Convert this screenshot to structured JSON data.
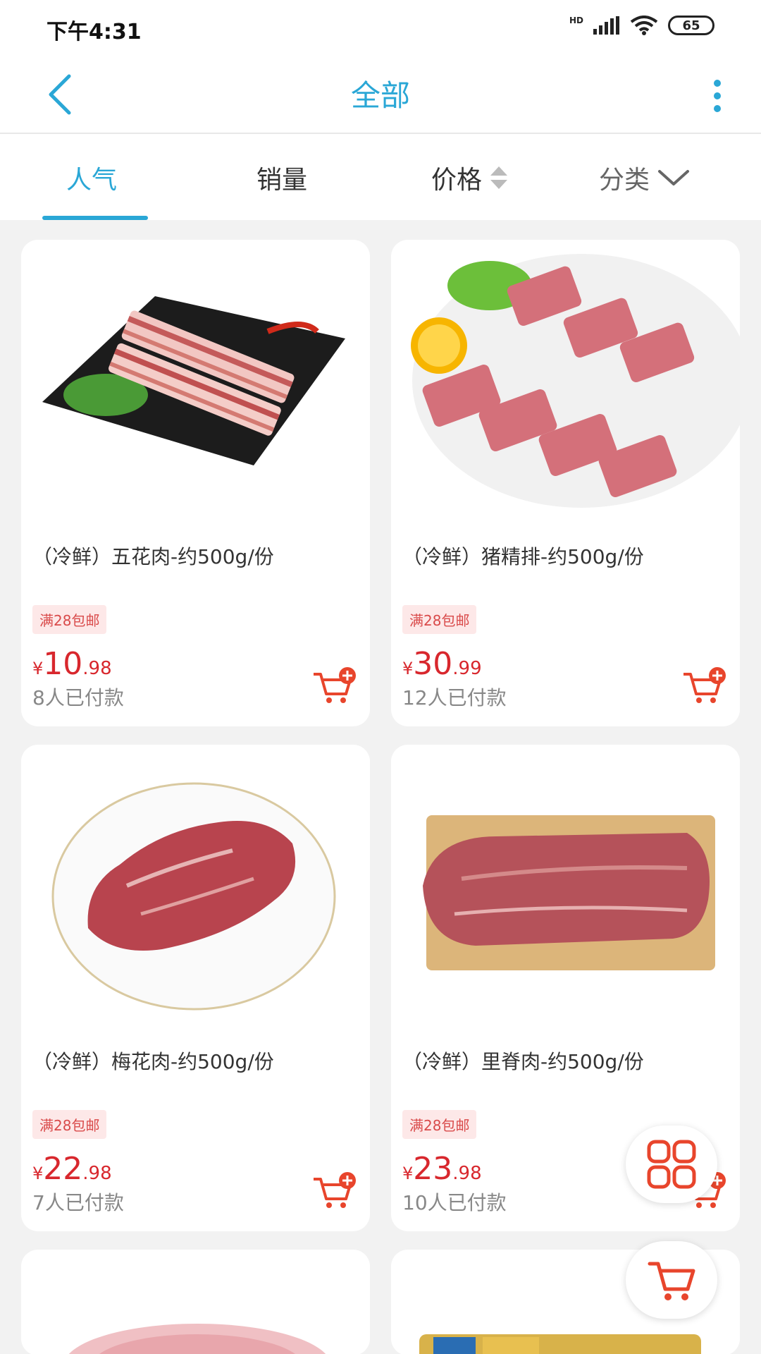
{
  "status_bar": {
    "time": "下午4:31",
    "hd_label": "HD",
    "battery": "65",
    "icons": [
      "signal-icon",
      "wifi-icon",
      "battery-icon"
    ]
  },
  "nav": {
    "title": "全部",
    "back_icon": "chevron-left-icon",
    "more_icon": "more-vertical-icon"
  },
  "filters": {
    "tabs": [
      {
        "label": "人气",
        "active": true
      },
      {
        "label": "销量",
        "active": false
      },
      {
        "label": "价格",
        "active": false,
        "icon": "sort-icon"
      },
      {
        "label": "分类",
        "active": false,
        "icon": "chevron-down-icon"
      }
    ]
  },
  "products": [
    {
      "title": "（冷鲜）五花肉-约500g/份",
      "badge": "满28包邮",
      "currency": "¥",
      "price_int": "10",
      "price_dec": ".98",
      "sold": "8人已付款"
    },
    {
      "title": "（冷鲜）猪精排-约500g/份",
      "badge": "满28包邮",
      "currency": "¥",
      "price_int": "30",
      "price_dec": ".99",
      "sold": "12人已付款"
    },
    {
      "title": "（冷鲜）梅花肉-约500g/份",
      "badge": "满28包邮",
      "currency": "¥",
      "price_int": "22",
      "price_dec": ".98",
      "sold": "7人已付款"
    },
    {
      "title": "（冷鲜）里脊肉-约500g/份",
      "badge": "满28包邮",
      "currency": "¥",
      "price_int": "23",
      "price_dec": ".98",
      "sold": "10人已付款"
    }
  ],
  "colors": {
    "accent": "#2aa7d6",
    "price": "#d8272d",
    "badge_bg": "#fde8e8",
    "fab_icon": "#e8452c"
  },
  "floating": {
    "grid_icon": "grid-icon",
    "cart_icon": "cart-icon"
  }
}
